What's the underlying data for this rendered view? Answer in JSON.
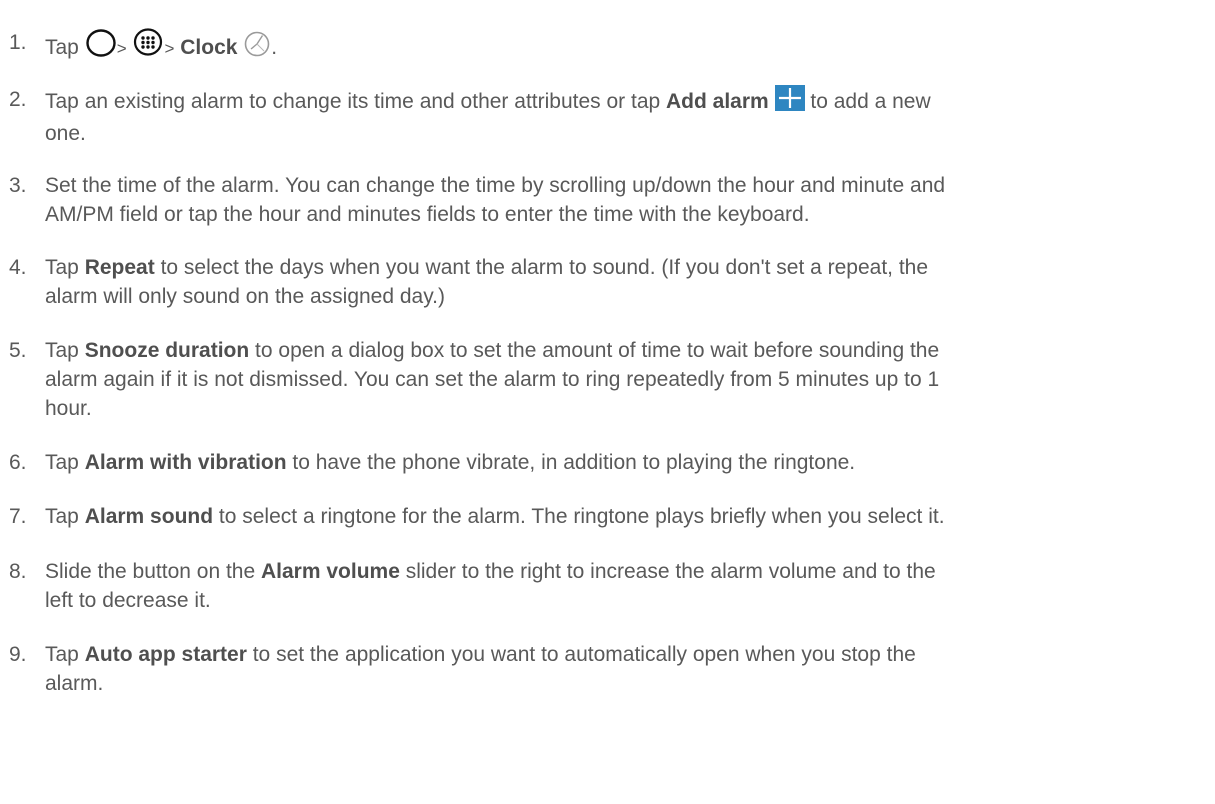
{
  "steps": [
    {
      "num": "1.",
      "tap": "Tap",
      "sep1": ">",
      "sep2": ">",
      "clock_label": "Clock",
      "end": ".",
      "icons": [
        "home-circle-icon",
        "apps-grid-icon",
        "clock-icon"
      ]
    },
    {
      "num": "2.",
      "a": "Tap an existing alarm to change its time and other attributes or tap ",
      "bold": "Add alarm",
      "b": " to add a new",
      "line2": "one.",
      "icon": "add-plus-icon",
      "icon_color": "#2e86c1"
    },
    {
      "num": "3.",
      "line1": "Set the time of the alarm. You can change the time by scrolling up/down the hour and minute and",
      "line2": "AM/PM field or tap the hour and minutes fields to enter the time with the keyboard."
    },
    {
      "num": "4.",
      "a": "Tap ",
      "bold": "Repeat",
      "b": " to select the days when you want the alarm to sound. (If you don't set a repeat, the",
      "line2": "alarm will only sound on the assigned day.)"
    },
    {
      "num": "5.",
      "a": "Tap ",
      "bold": "Snooze duration",
      "b": " to open a dialog box to set the amount of time to wait before sounding the",
      "line2": "alarm again if it is not dismissed. You can set the alarm to ring repeatedly from 5 minutes up to 1",
      "line3": "hour."
    },
    {
      "num": "6.",
      "a": "Tap ",
      "bold": "Alarm with vibration",
      "b": " to have the phone vibrate, in addition to playing the ringtone."
    },
    {
      "num": "7.",
      "a": "Tap ",
      "bold": "Alarm sound",
      "b": " to select a ringtone for the alarm. The ringtone plays briefly when you select it."
    },
    {
      "num": "8.",
      "a": "Slide the button on the ",
      "bold": "Alarm volume",
      "b": " slider to the right to increase the alarm volume and to the",
      "line2": "left to decrease it."
    },
    {
      "num": "9.",
      "a": "Tap ",
      "bold": "Auto app starter",
      "b": " to set the application you want to automatically open when you stop the",
      "line2": "alarm."
    }
  ]
}
